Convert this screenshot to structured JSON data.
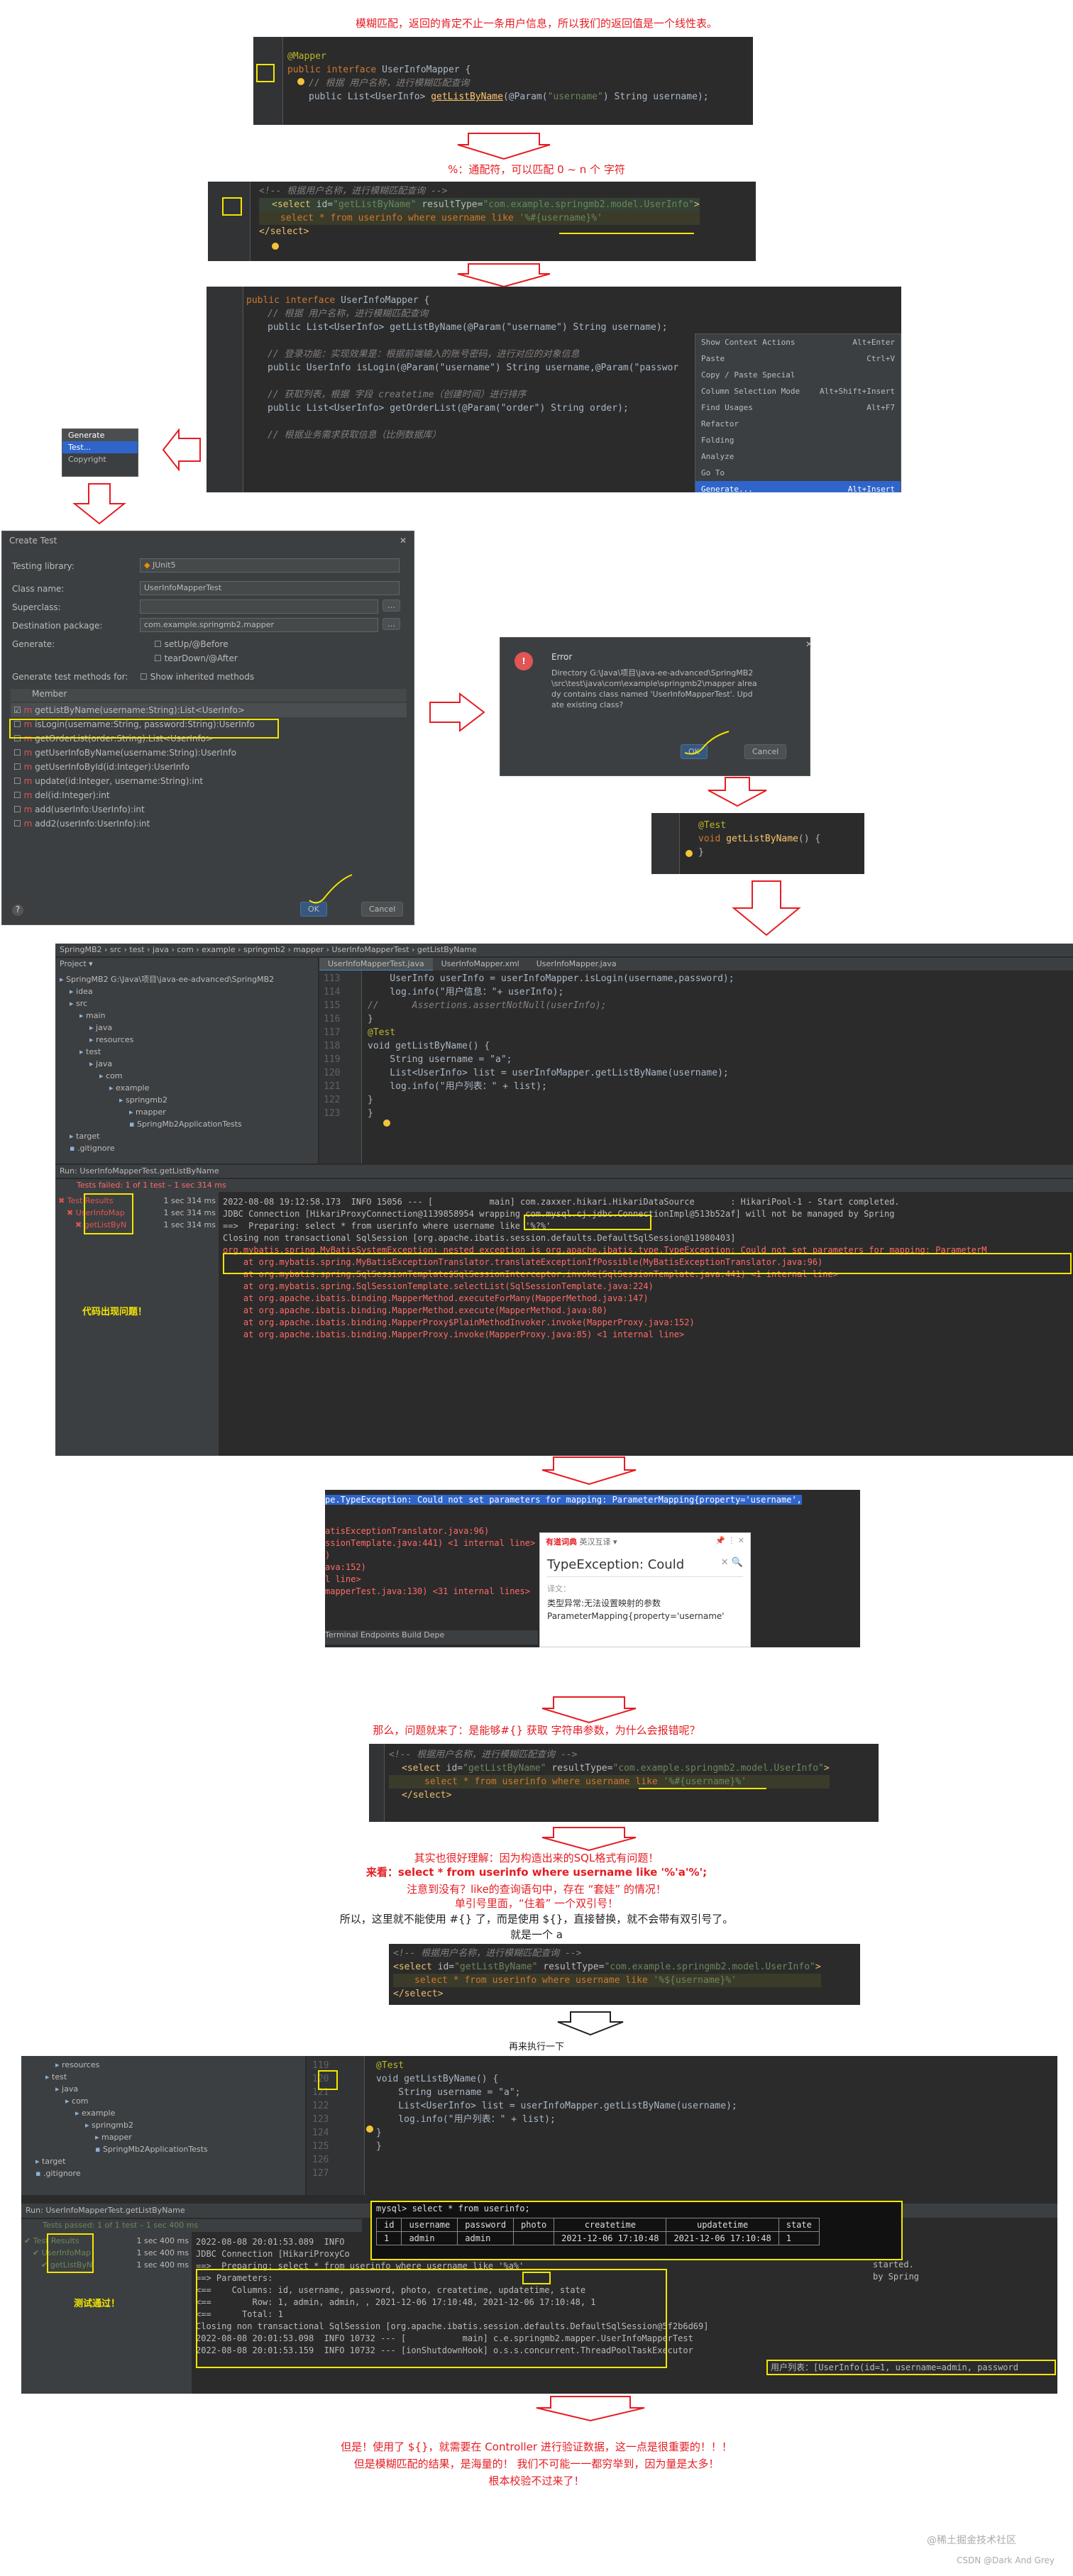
{
  "notes": {
    "n1": "模糊匹配，返回的肯定不止一条用户信息，所以我们的返回值是一个线性表。",
    "n2": "%：通配符，可以匹配 0 ~ n 个 字符",
    "n3": "那么，问题就来了：是能够#{} 获取 字符串参数，为什么会报错呢？",
    "n4a": "其实也很好理解：因为构造出来的SQL格式有问题！",
    "n4b": "来看：select * from userinfo where username like '%'a'%';",
    "n4c": "注意到没有？like的查询语句中，存在 “套娃” 的情况！",
    "n4d": "单引号里面，“住着” 一个双引号！",
    "n4e": "所以，这里就不能使用 #{} 了，而是使用 ${}，直接替换，就不会带有双引号了。",
    "n4f": "就是一个 a",
    "n5": "再来执行一下",
    "n6a": "但是！使用了 ${}，就需要在 Controller 进行验证数据，这一点是很重要的！！！",
    "n6b": "但是模糊匹配的结果，是海量的！ 我们不可能一一都穷举到，因为量是太多！",
    "n6c": "根本校验不过来了！",
    "code_err": "代码出现问题！",
    "test_ok": "测试通过！"
  },
  "code1": {
    "l1": "@Mapper",
    "l2a": "public interface ",
    "l2b": "UserInfoMapper {",
    "l3": "// 根据 用户名称，进行模糊匹配查询",
    "l4a": "public List<UserInfo> ",
    "l4b": "getListByName",
    "l4c": "(@Param(",
    "l4d": "\"username\"",
    "l4e": ") String username);"
  },
  "code2": {
    "l1": "<!--  根据用户名称，进行模糊匹配查询  -->",
    "l2a": "<select ",
    "l2b": "id=",
    "l2c": "\"getListByName\"",
    "l2d": " resultType=",
    "l2e": "\"com.example.springmb2.model.UserInfo\"",
    "l2f": ">",
    "l3a": "select * from userinfo where username like ",
    "l3b": "'%#{username}%'",
    "l4": "</select>"
  },
  "code3": {
    "l1a": "public interface ",
    "l1b": "UserInfoMapper {",
    "l2": "// 根据 用户名称，进行模糊匹配查询",
    "l3": "public List<UserInfo> getListByName(@Param(\"username\") String username);",
    "l4": "// 登录功能：实现效果是：根据前端输入的账号密码，进行对应的对象信息",
    "l5": "public UserInfo isLogin(@Param(\"username\") String username,@Param(\"passwor",
    "l6": "// 获取列表，根据 字段 createtime（创建时间）进行排序",
    "l7": "public List<UserInfo> getOrderList(@Param(\"order\") String order);",
    "l8": "// 根据业务需求获取信息（比例数据库）"
  },
  "ctx_menu": [
    {
      "label": "Show Context Actions",
      "key": "Alt+Enter"
    },
    {
      "label": "Paste",
      "key": "Ctrl+V"
    },
    {
      "label": "Copy / Paste Special",
      "key": ""
    },
    {
      "label": "Column Selection Mode",
      "key": "Alt+Shift+Insert"
    },
    {
      "label": "Find Usages",
      "key": "Alt+F7"
    },
    {
      "label": "Refactor",
      "key": ""
    },
    {
      "label": "Folding",
      "key": ""
    },
    {
      "label": "Analyze",
      "key": ""
    },
    {
      "label": "Go To",
      "key": ""
    },
    {
      "label": "Generate...",
      "key": "Alt+Insert"
    }
  ],
  "gen_menu": [
    "Generate",
    "Test...",
    "Copyright"
  ],
  "create_test": {
    "title": "Create Test",
    "lib_label": "Testing library:",
    "lib_value": "JUnit5",
    "class_label": "Class name:",
    "class_value": "UserInfoMapperTest",
    "super_label": "Superclass:",
    "super_value": "",
    "dest_label": "Destination package:",
    "dest_value": "com.example.springmb2.mapper",
    "gen_label": "Generate:",
    "gen_opt1": "setUp/@Before",
    "gen_opt2": "tearDown/@After",
    "methods_label": "Generate test methods for:",
    "inherited": "Show inherited methods",
    "member_header": "Member",
    "members": [
      "getListByName(username:String):List<UserInfo>",
      "isLogin(username:String, password:String):UserInfo",
      "getOrderList(order:String):List<UserInfo>",
      "getUserInfoByName(username:String):UserInfo",
      "getUserInfoById(id:Integer):UserInfo",
      "update(id:Integer, username:String):int",
      "del(id:Integer):int",
      "add(userInfo:UserInfo):int",
      "add2(userInfo:UserInfo):int"
    ],
    "ok": "OK",
    "cancel": "Cancel",
    "help": "?"
  },
  "error_dialog": {
    "title": "Error",
    "msg": "Directory G:\\Java\\项目\\java-ee-advanced\\SpringMB2\\src\\test\\java\\com\\example\\springmb2\\mapper already contains class named 'UserInfoMapperTest'. Update existing class?",
    "ok": "OK",
    "cancel": "Cancel"
  },
  "code4": {
    "l1": "@Test",
    "l2a": "void ",
    "l2b": "getListByName",
    "l2c": "() {",
    "l3": "}"
  },
  "ide1": {
    "menubar": [
      "SpringMB2",
      "src",
      "test",
      "java",
      "com",
      "example",
      "springmb2",
      "mapper",
      "UserInfoMapperTest",
      "getListByName"
    ],
    "tabs": [
      "UserInfoMapperTest.java",
      "UserInfoMapper.xml",
      "UserInfoMapper.java"
    ],
    "run_config": "UserInfoMapperTest.getListByName",
    "project_label": "Project",
    "tree": [
      "SpringMB2  G:\\Java\\项目\\java-ee-advanced\\SpringMB2",
      "idea",
      "src",
      "main",
      "java",
      "resources",
      "test",
      "java",
      "com",
      "example",
      "springmb2",
      "mapper",
      "SpringMb2ApplicationTests",
      "target",
      ".gitignore"
    ],
    "line_nums": [
      "113",
      "114",
      "115",
      "116",
      "117",
      "118",
      "119",
      "120",
      "121",
      "122",
      "123"
    ],
    "code": [
      "    UserInfo userInfo = userInfoMapper.isLogin(username,password);",
      "    log.info(\"用户信息：\"+ userInfo);",
      "//      Assertions.assertNotNull(userInfo);",
      "}",
      "",
      "@Test",
      "void getListByName() {",
      "    String username = \"a\";",
      "    List<UserInfo> list = userInfoMapper.getListByName(username);",
      "    log.info(\"用户列表：\" + list);",
      "}",
      "",
      "}"
    ],
    "run_tab": "UserInfoMapperTest.getListByName",
    "run_label": "Run:",
    "status": "Tests failed: 1 of 1 test – 1 sec 314 ms",
    "results": [
      "Test Results",
      "UserInfoMap",
      "getListByN"
    ],
    "times": [
      "1 sec 314 ms",
      "1 sec 314 ms",
      "1 sec 314 ms"
    ],
    "console": [
      "2022-08-08 19:12:58.173  INFO 15056 --- [           main] com.zaxxer.hikari.HikariDataSource       : HikariPool-1 - Start completed.",
      "JDBC Connection [HikariProxyConnection@1139858954 wrapping com.mysql.cj.jdbc.ConnectionImpl@513b52af] will not be managed by Spring",
      "==>  Preparing: select * from userinfo where username like '%?%'",
      "Closing non transactional SqlSession [org.apache.ibatis.session.defaults.DefaultSqlSession@11980403]",
      "",
      "org.mybatis.spring.MyBatisSystemException: nested exception is org.apache.ibatis.type.TypeException: Could not set parameters for mapping: ParameterM",
      "",
      "    at org.mybatis.spring.MyBatisExceptionTranslator.translateExceptionIfPossible(MyBatisExceptionTranslator.java:96)",
      "    at org.mybatis.spring.SqlSessionTemplate$SqlSessionInterceptor.invoke(SqlSessionTemplate.java:441) <1 internal line>",
      "    at org.mybatis.spring.SqlSessionTemplate.selectList(SqlSessionTemplate.java:224)",
      "    at org.apache.ibatis.binding.MapperMethod.executeForMany(MapperMethod.java:147)",
      "    at org.apache.ibatis.binding.MapperMethod.execute(MapperMethod.java:80)",
      "    at org.apache.ibatis.binding.MapperProxy$PlainMethodInvoker.invoke(MapperProxy.java:152)",
      "    at org.apache.ibatis.binding.MapperProxy.invoke(MapperProxy.java:85) <1 internal line>"
    ]
  },
  "translate": {
    "console_top": "pe.TypeException: Could not set parameters for mapping: ParameterMapping{property='username',",
    "console_lines": [
      "atisExceptionTranslator.java:96)",
      "ssionTemplate.java:441) <1 internal line>",
      ")",
      "",
      "ava:152)",
      "l line>",
      "mapperTest.java:130) <31 internal lines>"
    ],
    "bottom_tabs": [
      "Terminal",
      "Endpoints",
      "Build",
      "Depe"
    ],
    "brand": "有道词典",
    "mode": "英汉互译 ▾",
    "query": "TypeException: Could",
    "label": "译文：",
    "result": "类型异常:无法设置映射的参数ParameterMapping{property='username'"
  },
  "code5": {
    "l1": "<!--  根据用户名称，进行模糊匹配查询  -->",
    "l2a": "<select ",
    "l2b": "id=",
    "l2c": "\"getListByName\"",
    "l2d": " resultType=",
    "l2e": "\"com.example.springmb2.model.UserInfo\"",
    "l2f": ">",
    "l3a": "select * from userinfo where username like ",
    "l3b": "'%#{username}%'",
    "l4": "</select>"
  },
  "code6": {
    "l1": "<!--  根据用户名称，进行模糊匹配查询  -->",
    "l2a": "<select ",
    "l2b": "id=",
    "l2c": "\"getListByName\"",
    "l2d": " resultType=",
    "l2e": "\"com.example.springmb2.model.UserInfo\"",
    "l2f": ">",
    "l3a": "select * from userinfo where username like ",
    "l3b": "'%${username}%'",
    "l4": "</select>"
  },
  "ide2": {
    "tree": [
      "resources",
      "test",
      "java",
      "com",
      "example",
      "springmb2",
      "mapper",
      "SpringMb2ApplicationTests",
      "target",
      ".gitignore"
    ],
    "line_nums": [
      "119",
      "120",
      "121",
      "122",
      "123",
      "124",
      "125",
      "126",
      "127"
    ],
    "code": [
      "@Test",
      "void getListByName() {",
      "    String username = \"a\";",
      "    List<UserInfo> list = userInfoMapper.getListByName(username);",
      "    log.info(\"用户列表：\" + list);",
      "}",
      "",
      "}"
    ],
    "run_label": "Run:",
    "run_tab": "UserInfoMapperTest.getListByName",
    "status": "Tests passed: 1 of 1 test – 1 sec 400 ms",
    "results": [
      "Test Results",
      "UserInfoMap",
      "getListByN"
    ],
    "times": [
      "1 sec 400 ms",
      "1 sec 400 ms",
      "1 sec 400 ms"
    ],
    "mysql_prompt": "mysql> select * from userinfo;",
    "mysql_headers": [
      "id",
      "username",
      "password",
      "photo",
      "createtime",
      "updatetime",
      "state"
    ],
    "mysql_row": [
      "1",
      "admin",
      "admin",
      "",
      "2021-12-06 17:10:48",
      "2021-12-06 17:10:48",
      "1"
    ],
    "console": [
      "2022-08-08 20:01:53.089  INFO",
      "JDBC Connection [HikariProxyCo",
      "==>  Preparing: select * from userinfo where username like '%a%'",
      "==> Parameters: ",
      "<==    Columns: id, username, password, photo, createtime, updatetime, state",
      "<==        Row: 1, admin, admin, , 2021-12-06 17:10:48, 2021-12-06 17:10:48, 1",
      "<==      Total: 1",
      "Closing non transactional SqlSession [org.apache.ibatis.session.defaults.DefaultSqlSession@5f2b6d69]",
      "2022-08-08 20:01:53.098  INFO 10732 --- [           main] c.e.springmb2.mapper.UserInfoMapperTest",
      "2022-08-08 20:01:53.159  INFO 10732 --- [ionShutdownHook] o.s.s.concurrent.ThreadPoolTaskExecutor"
    ],
    "console_right": [
      "started.",
      "by Spring"
    ],
    "list_out": "用户列表：[UserInfo(id=1, username=admin, password"
  },
  "watermark1": "@稀土掘金技术社区",
  "watermark2": "CSDN @Dark And Grey"
}
